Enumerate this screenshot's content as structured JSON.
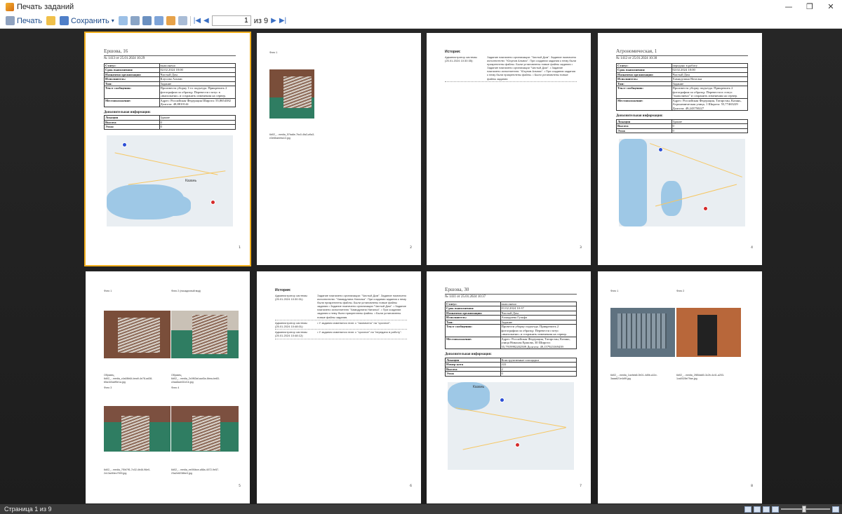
{
  "window": {
    "title": "Печать заданий"
  },
  "toolbar": {
    "print": "Печать",
    "save": "Сохранить",
    "page": "1",
    "of": "из 9"
  },
  "status": {
    "text": "Страница 1 из 9"
  },
  "pages": [
    {
      "n": "1",
      "title": "Ершова, 16",
      "sub": "№ 1413 от 25.01.2024 10:29",
      "rows": [
        [
          "Статус:",
          "выполнено"
        ],
        [
          "Срок выполнения:",
          "02.02.2024 18:00"
        ],
        [
          "Назначено организации:",
          "Чистый Дом"
        ],
        [
          "Исполнитель:",
          "Клусова Альвис"
        ],
        [
          "Тип:",
          "Задание"
        ],
        [
          "Текст сообщения:",
          "Произвести уборку 1-го подъезда. Прикрепить 2 фотографии по образцу. Перевести статус в «выполнено» и сохранить изменения на сервер."
        ],
        [
          "Местоположение:",
          "Адрес: Российская Федерация Широта: 55,8654382 Долгота: 48,8810144"
        ]
      ],
      "addl": "Дополнительная информация:",
      "extra": [
        [
          "Локация",
          "Здание"
        ],
        [
          "Высота",
          "0"
        ],
        [
          "Этаж:",
          "0"
        ]
      ],
      "map": "Казань"
    },
    {
      "n": "2",
      "photo_label": "Фото 1",
      "file": "6d02_...media_57ba6e-7bc0-4fa3-a9a3-e3e6baeeba13.jpg"
    },
    {
      "n": "3",
      "hist": "История:",
      "hrows": [
        [
          "Администратор системы (25.01.2024 10:30:35):",
          "Задание назначено организации: \"Чистый Дом\". Задание назначено исполнителю: \"Юсупов Альвис\". При создании задания к нему были прикреплены файлы. Были установлены новые файлы задания • Задание назначено организации \"Чистый Дом\". • Задание назначено исполнителю: \"Юсупов Альвис\". • При создании задания к нему были прикреплены файлы. • Были установлены новые файлы задания"
        ]
      ]
    },
    {
      "n": "4",
      "title": "Агрономическая, 1",
      "sub": "№ 1412 от 25.01.2024 10:30",
      "rows": [
        [
          "Статус:",
          "передано в работу"
        ],
        [
          "Срок выполнения:",
          "02.02.2024 18:00"
        ],
        [
          "Назначено организации:",
          "Чистый Дом"
        ],
        [
          "Исполнитель:",
          "Хамидулина Наталья"
        ],
        [
          "Тип:",
          "Задание"
        ],
        [
          "Текст сообщения:",
          "Произвести уборку подъезда. Прикрепить 2 фотографии по образцу. Перевести в статус \"выполнено\" и сохранить изменения на сервер."
        ],
        [
          "Местоположение:",
          "Адрес: Российская Федерация, Татарстан, Казань, Агрономическая улица, 1 Широта: 55,77465229 Долгота: 49,243750227"
        ]
      ],
      "addl": "Дополнительная информация:",
      "extra": [
        [
          "Локация",
          "Здание"
        ],
        [
          "Высота",
          "0"
        ],
        [
          "Этаж",
          "0"
        ]
      ]
    },
    {
      "n": "5",
      "p1": "Фото 1",
      "p2": "Фото 2 (посадочный вид)",
      "p3": "Фото 3",
      "p4": "Фото 4",
      "o1": "Образец",
      "o2": "Образец",
      "f1": "6d02_...media_c4a08b64-bea9-4e78-ad38-65a1b0adf5e1a.jpg",
      "f2": "6d02_...media_2c0f63af-acd0a-6bea-be83-c0aa6ad431e1b.jpg",
      "f3": "6d02_...media_7f0b7ff1-7c02-4b46-96e0-2c13a4f4ec7593.jpg",
      "f4": "6d02_...media_ee0f4bce-c88a-4072-9e57-23a2e8238be3.jpg"
    },
    {
      "n": "6",
      "hist": "История:",
      "hrows": [
        [
          "Администратор системы (25.01.2024 10:30:31):",
          "Задание назначено организации: \"Чистый Дом\". Задание назначено исполнителю: \"Хамидулина Наталья\". При создании задания к нему были прикреплены файлы. Были установлены новые файлы задания • Задание назначено организации \"Чистый Дом\". • Задание назначено исполнителю \"Хамидулина Наталья\". • При создании задания к нему были прикреплены файлы. • Были установлены новые файлы задания."
        ],
        [
          "Администратор системы (25.01.2024 10:48:01):",
          "• У задания изменился этап: с \"назначено\" на \"срочное\"."
        ],
        [
          "Администратор системы (25.01.2024 10:48:12):",
          "• У задания изменился этап: с \"срочное\" на \"передано в работу\"."
        ]
      ]
    },
    {
      "n": "7",
      "title": "Ершова, 30",
      "sub": "№ 1411 от 25.01.2024 10:37",
      "rows": [
        [
          "Статус:",
          "выполнено"
        ],
        [
          "Срок выполнения:",
          "01.02.2024 10:37"
        ],
        [
          "Назначено организации:",
          "Чистый Дом"
        ],
        [
          "Исполнитель:",
          "Ахмадиева Гульфа"
        ],
        [
          "Тип:",
          "Задание"
        ],
        [
          "Текст сообщения:",
          "Провести уборку подъезда. Прикрепить 2 фотографии по образцу. Перевести статус «выполнено» и сохранить изменения на сервер."
        ],
        [
          "Местоположение:",
          "Адрес: Российская Федерация, Татарстан, Казань, улица Николая Ершова, 30 Широта: 55,7919992202509 Долгота: 49,157923169439"
        ]
      ],
      "addl": "Дополнительная информация:",
      "extra": [
        [
          "Локация",
          "Конструктивные площадки"
        ],
        [
          "Номер кота",
          "222"
        ],
        [
          "Высота",
          "2"
        ],
        [
          "Этаж",
          "0"
        ]
      ],
      "map": "Казань"
    },
    {
      "n": "8",
      "p1": "Фото 1",
      "p2": "Фото 2",
      "f1": "6d02_...media_1acfcfa8-0b01-4d5b-a11e-3aaa621e4d9f.jpg",
      "f2": "6d02_...media_2f85da60-3c2b-4c41-a203-1ca0028e79ae.jpg"
    }
  ]
}
